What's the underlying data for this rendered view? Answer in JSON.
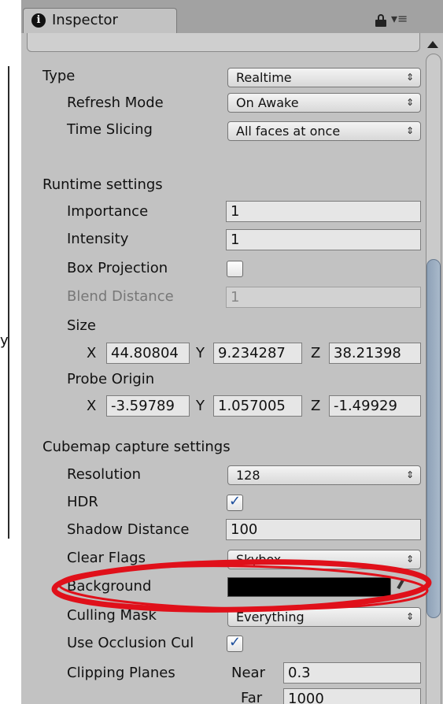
{
  "tab": {
    "title": "Inspector",
    "icon": "info-icon"
  },
  "accent_colors": {
    "panel_bg": "#c2c2c2",
    "scroll_thumb": "#99acc1",
    "annotation": "#e0101a"
  },
  "type": {
    "label": "Type",
    "value": "Realtime"
  },
  "refresh_mode": {
    "label": "Refresh Mode",
    "value": "On Awake"
  },
  "time_slicing": {
    "label": "Time Slicing",
    "value": "All faces at once"
  },
  "runtime": {
    "header": "Runtime settings",
    "importance": {
      "label": "Importance",
      "value": "1"
    },
    "intensity": {
      "label": "Intensity",
      "value": "1"
    },
    "box_projection": {
      "label": "Box Projection",
      "checked": false
    },
    "blend_distance": {
      "label": "Blend Distance",
      "value": "1"
    },
    "size": {
      "label": "Size",
      "x_label": "X",
      "x": "44.80804",
      "y_label": "Y",
      "y": "9.234287",
      "z_label": "Z",
      "z": "38.21398"
    },
    "probe_origin": {
      "label": "Probe Origin",
      "x_label": "X",
      "x": "-3.59789",
      "y_label": "Y",
      "y": "1.057005",
      "z_label": "Z",
      "z": "-1.49929"
    }
  },
  "cubemap": {
    "header": "Cubemap capture settings",
    "resolution": {
      "label": "Resolution",
      "value": "128"
    },
    "hdr": {
      "label": "HDR",
      "checked": true
    },
    "shadow_distance": {
      "label": "Shadow Distance",
      "value": "100"
    },
    "clear_flags": {
      "label": "Clear Flags",
      "value": "Skybox"
    },
    "background": {
      "label": "Background",
      "color": "#000000"
    },
    "culling_mask": {
      "label": "Culling Mask",
      "value": "Everything"
    },
    "occlusion": {
      "label": "Use Occlusion Cul",
      "checked": true
    },
    "clipping": {
      "label": "Clipping Planes",
      "near_label": "Near",
      "near": "0.3",
      "far_label": "Far",
      "far": "1000"
    }
  }
}
